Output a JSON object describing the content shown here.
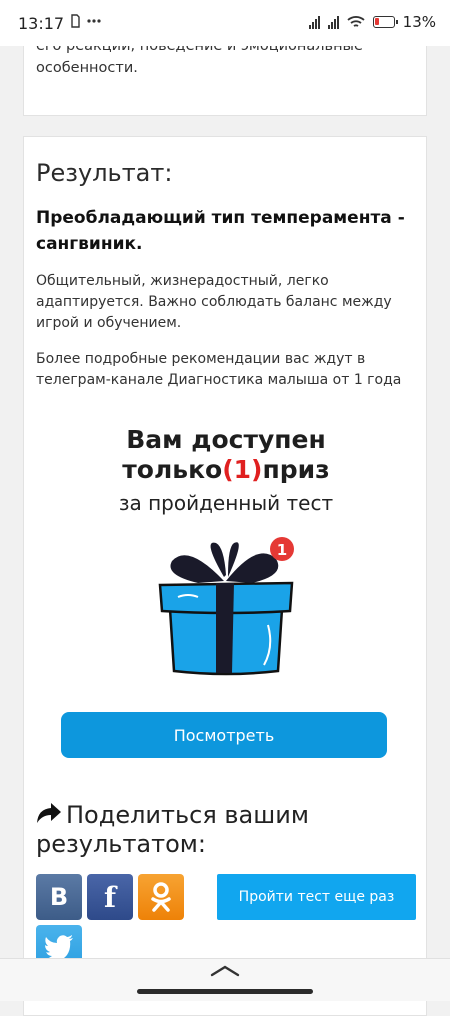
{
  "status_bar": {
    "time": "13:17",
    "battery_text": "13%",
    "left_icons": [
      "sim-icon",
      "more-dots-icon"
    ],
    "right_icons": [
      "signal-icon",
      "signal-icon",
      "wifi-icon",
      "battery-icon"
    ]
  },
  "top_card": {
    "text": "его реакции, поведение и эмоциональные особенности."
  },
  "result": {
    "title": "Результат:",
    "type_title": "Преобладающий тип темперамента - сангвиник.",
    "description": "Общительный, жизнерадостный, легко адаптируется. Важно соблюдать баланс между игрой и обучением.",
    "more_text": "Более подробные рекомендации вас ждут в телеграм-канале Диагностика малыша от 1 года"
  },
  "prize": {
    "line1": "Вам доступен",
    "line2_before": "только",
    "count": "(1)",
    "line2_after": "приз",
    "subtitle": "за пройденный тест",
    "badge": "1",
    "view_button": "Посмотреть"
  },
  "share": {
    "title": "Поделиться вашим результатом:",
    "networks": [
      {
        "name": "vk",
        "label": "В",
        "color": "#4d6d9a"
      },
      {
        "name": "facebook",
        "label": "f",
        "color": "#3b5998"
      },
      {
        "name": "odnoklassniki",
        "label": "ок",
        "color": "#f59018"
      },
      {
        "name": "twitter",
        "label": "twitter",
        "color": "#37a8e8"
      }
    ],
    "retry_button": "Пройти тест еще раз"
  },
  "colors": {
    "accent": "#0d97dd",
    "retry": "#11a6ef",
    "highlight": "#e02020"
  }
}
